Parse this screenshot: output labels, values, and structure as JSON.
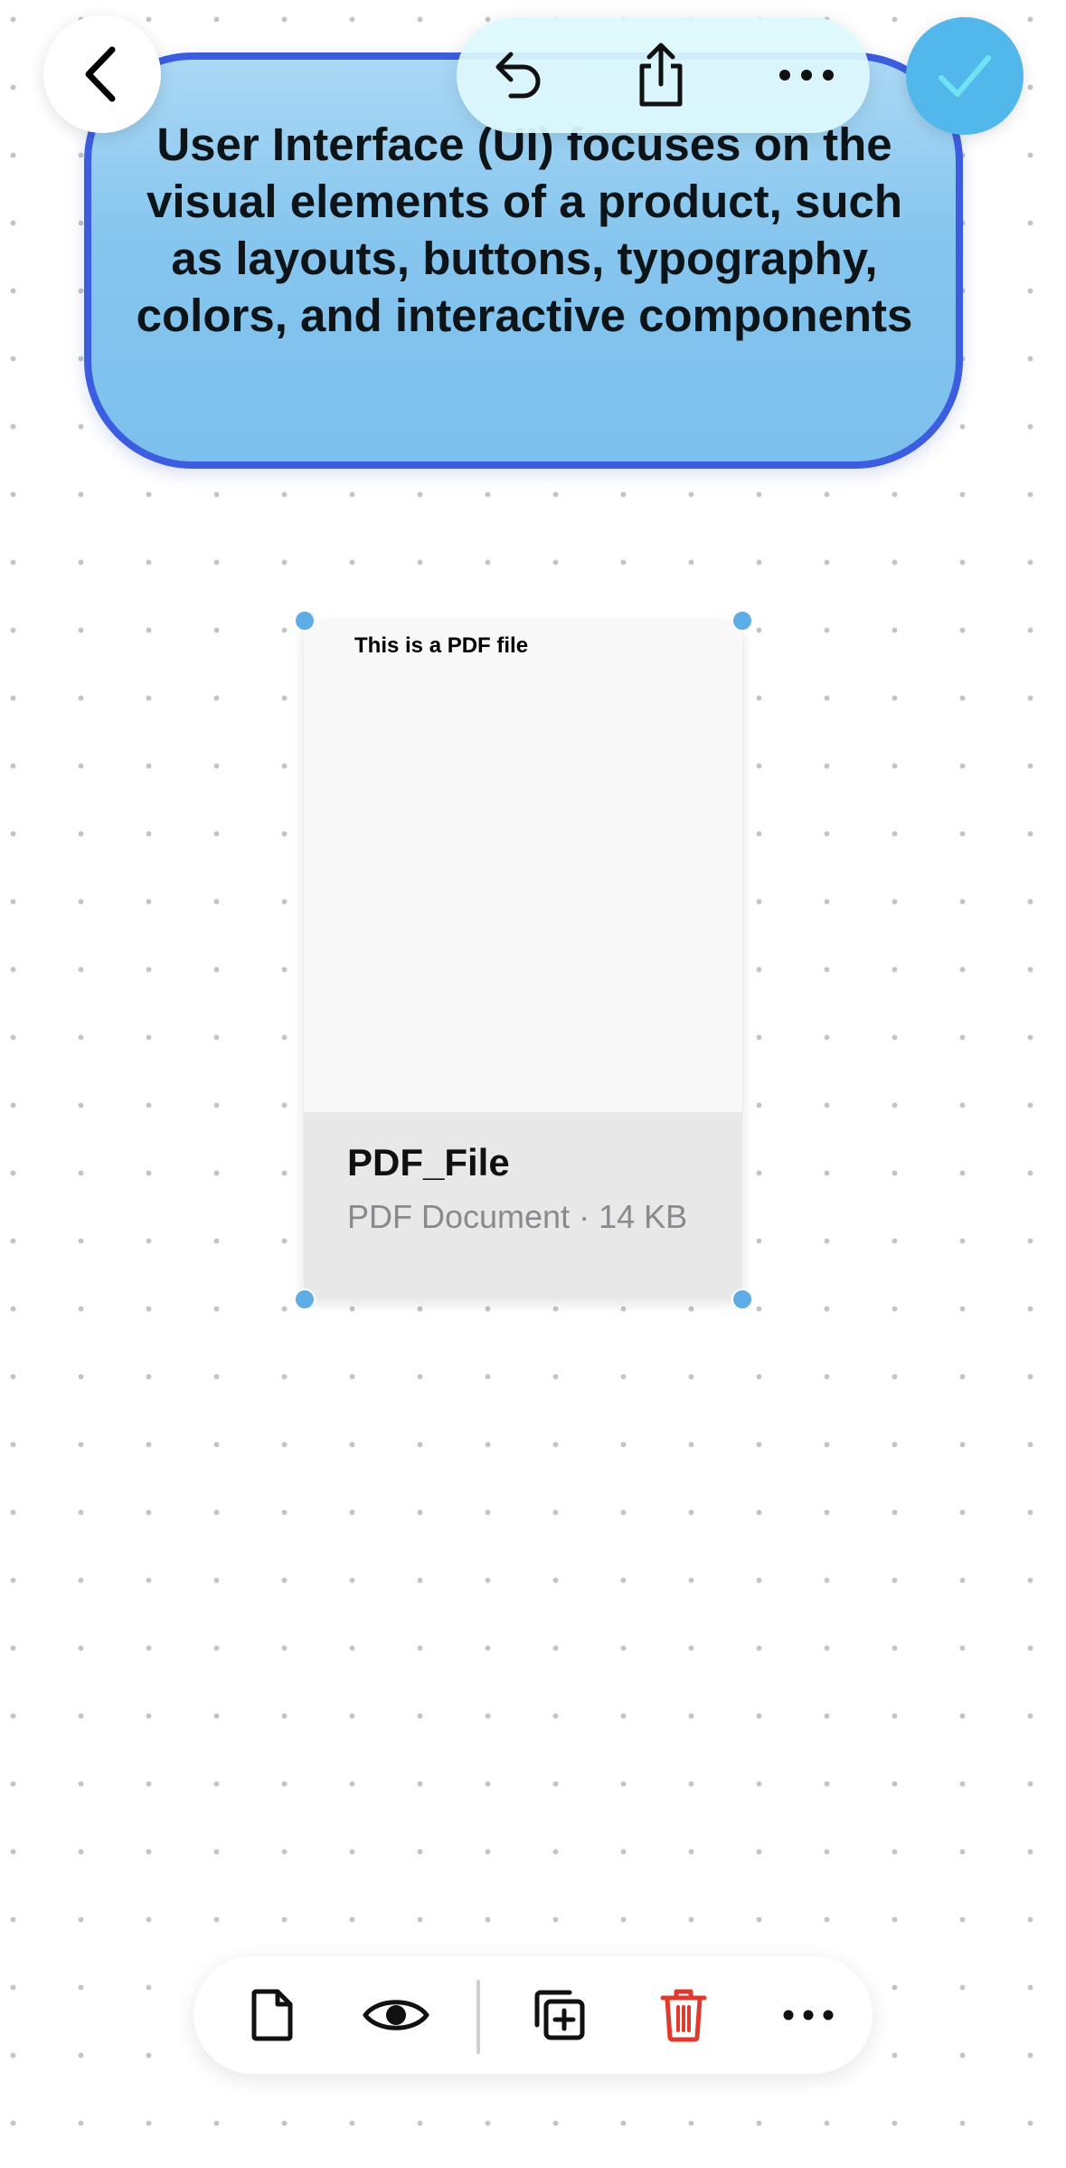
{
  "note": {
    "text": "User Interface (UI) focuses on the visual elements of a product, such as layouts, buttons, typography, colors, and interactive components"
  },
  "top_bar": {
    "back_icon": "chevron-left-icon",
    "undo_icon": "undo-icon",
    "share_icon": "share-icon",
    "more_icon": "ellipsis-icon",
    "done_icon": "checkmark-icon"
  },
  "pdf_card": {
    "preview_text": "This is a PDF file",
    "file_name": "PDF_File",
    "file_meta": "PDF Document · 14 KB"
  },
  "toolbar": {
    "items": [
      "document-icon",
      "eye-icon",
      "duplicate-icon",
      "trash-icon",
      "ellipsis-icon"
    ]
  },
  "colors": {
    "note_fill": "#86c5ee",
    "note_border": "#3c5de0",
    "accent": "#52b7ea",
    "handle": "#5fade6",
    "delete": "#e03a2f"
  }
}
